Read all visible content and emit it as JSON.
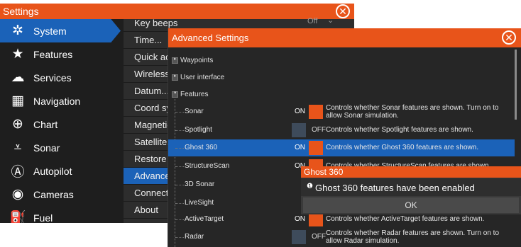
{
  "settings": {
    "title": "Settings",
    "categories": [
      {
        "label": "System",
        "icon": "gear-icon",
        "glyph": "✲"
      },
      {
        "label": "Features",
        "icon": "star-icon",
        "glyph": "★"
      },
      {
        "label": "Services",
        "icon": "cloud-icon",
        "glyph": "☁"
      },
      {
        "label": "Navigation",
        "icon": "navigation-icon",
        "glyph": "▦"
      },
      {
        "label": "Chart",
        "icon": "globe-icon",
        "glyph": "⊕"
      },
      {
        "label": "Sonar",
        "icon": "sonar-icon",
        "glyph": "⩡"
      },
      {
        "label": "Autopilot",
        "icon": "autopilot-icon",
        "glyph": "Ⓐ"
      },
      {
        "label": "Cameras",
        "icon": "camera-icon",
        "glyph": "◉"
      },
      {
        "label": "Fuel",
        "icon": "fuel-icon",
        "glyph": "⛽"
      }
    ],
    "items": [
      {
        "label": "Key beeps",
        "value": "Off"
      },
      {
        "label": "Time..."
      },
      {
        "label": "Quick acc"
      },
      {
        "label": "Wireless"
      },
      {
        "label": "Datum..."
      },
      {
        "label": "Coord sys"
      },
      {
        "label": "Magnetic"
      },
      {
        "label": "Satellites"
      },
      {
        "label": "Restore d"
      },
      {
        "label": "Advanced"
      },
      {
        "label": "Connect"
      },
      {
        "label": "About"
      }
    ]
  },
  "advanced": {
    "title": "Advanced Settings",
    "tree": [
      {
        "label": "Waypoints"
      },
      {
        "label": "User interface"
      },
      {
        "label": "Features"
      }
    ],
    "features": [
      {
        "name": "Sonar",
        "state": "ON",
        "desc": "Controls whether Sonar features are shown. Turn on to allow Sonar simulation."
      },
      {
        "name": "Spotlight",
        "state": "OFF",
        "desc": "Controls whether Spotlight features are shown."
      },
      {
        "name": "Ghost 360",
        "state": "ON",
        "desc": "Controls whether Ghost 360 features are shown."
      },
      {
        "name": "StructureScan",
        "state": "ON",
        "desc": "Controls whether StructureScan features are shown."
      },
      {
        "name": "3D Sonar",
        "state": "",
        "desc": ""
      },
      {
        "name": "LiveSight",
        "state": "",
        "desc": ""
      },
      {
        "name": "ActiveTarget",
        "state": "ON",
        "desc": "Controls whether ActiveTarget features are shown."
      },
      {
        "name": "Radar",
        "state": "OFF",
        "desc": "Controls whether Radar features are shown. Turn on to allow Radar simulation."
      }
    ]
  },
  "popup": {
    "title": "Ghost 360",
    "message": "Ghost 360 features have been enabled",
    "ok": "OK"
  },
  "colors": {
    "accent": "#e8541a",
    "selection": "#1b62b8"
  }
}
